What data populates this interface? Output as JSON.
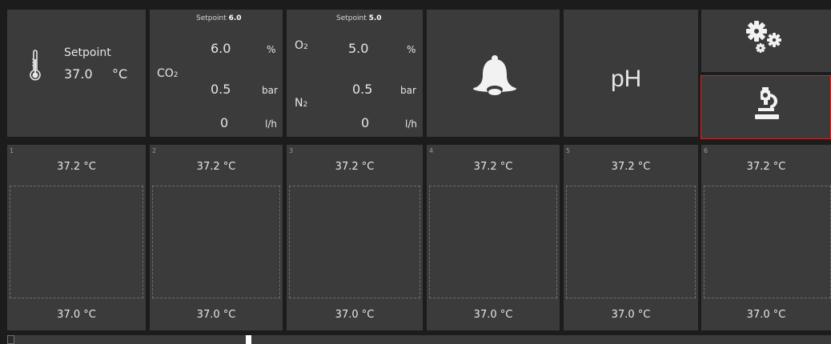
{
  "temperature": {
    "label": "Setpoint",
    "value": "37.0",
    "unit": "°C",
    "icon": "thermometer-icon"
  },
  "co2": {
    "setpoint_label": "Setpoint",
    "setpoint_value": "6.0",
    "gas": "CO",
    "gas_sub": "2",
    "percent": "6.0",
    "percent_unit": "%",
    "pressure": "0.5",
    "pressure_unit": "bar",
    "flow": "0",
    "flow_unit": "l/h"
  },
  "o2n2": {
    "setpoint_label": "Setpoint",
    "setpoint_value": "5.0",
    "gas_o": "O",
    "gas_o_sub": "2",
    "gas_n": "N",
    "gas_n_sub": "2",
    "percent": "5.0",
    "percent_unit": "%",
    "pressure": "0.5",
    "pressure_unit": "bar",
    "flow": "0",
    "flow_unit": "l/h"
  },
  "alarm": {
    "icon": "bell-icon"
  },
  "ph": {
    "label": "pH"
  },
  "settings": {
    "icon": "gears-icon"
  },
  "microscope": {
    "icon": "microscope-icon",
    "selected_color": "#e02020"
  },
  "chambers": [
    {
      "number": "1",
      "current": "37.2 °C",
      "setpoint": "37.0 °C"
    },
    {
      "number": "2",
      "current": "37.2 °C",
      "setpoint": "37.0 °C"
    },
    {
      "number": "3",
      "current": "37.2 °C",
      "setpoint": "37.0 °C"
    },
    {
      "number": "4",
      "current": "37.2 °C",
      "setpoint": "37.0 °C"
    },
    {
      "number": "5",
      "current": "37.2 °C",
      "setpoint": "37.0 °C"
    },
    {
      "number": "6",
      "current": "37.2 °C",
      "setpoint": "37.0 °C"
    }
  ]
}
